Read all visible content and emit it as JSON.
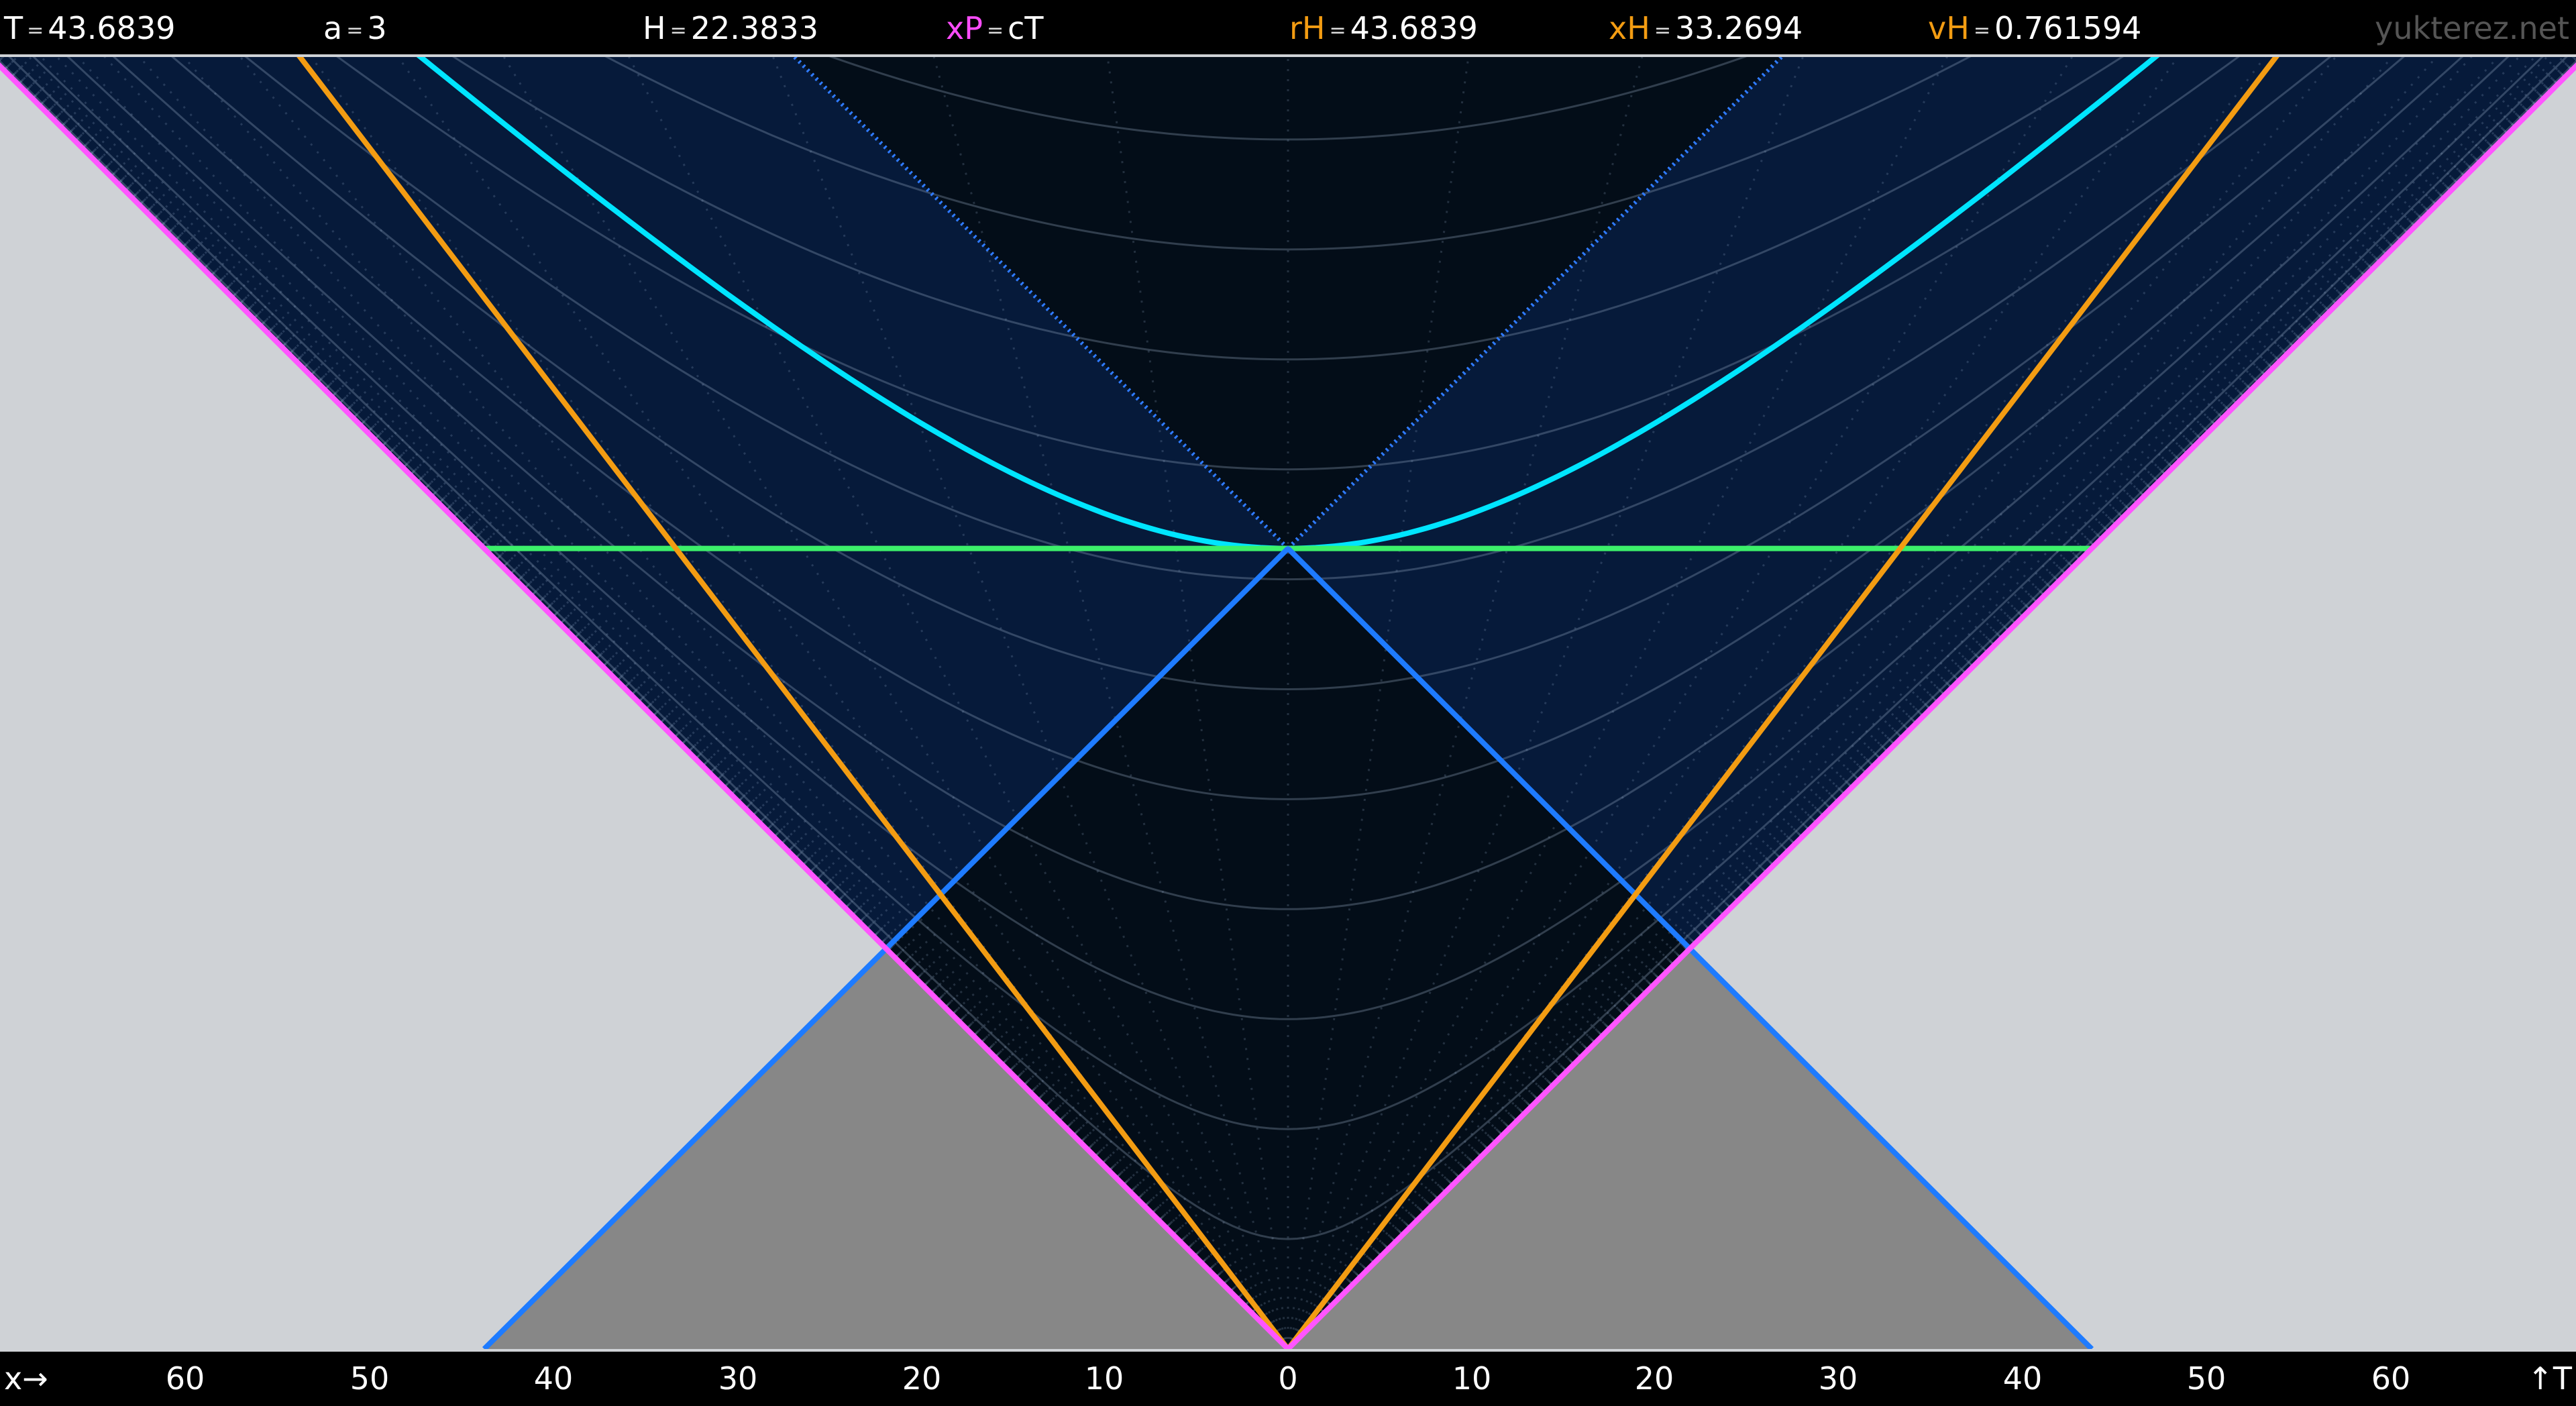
{
  "header": {
    "T": {
      "label": "T",
      "eq": "=",
      "value": "43.6839"
    },
    "a": {
      "label": "a",
      "eq": "=",
      "value": "3"
    },
    "H": {
      "label": "H",
      "eq": "=",
      "value": "22.3833"
    },
    "xP": {
      "label": "xP",
      "eq": "=",
      "value": "cT"
    },
    "rH": {
      "label": "rH",
      "eq": "=",
      "value": "43.6839"
    },
    "xH": {
      "label": "xH",
      "eq": "=",
      "value": "33.2694"
    },
    "vH": {
      "label": "vH",
      "eq": "=",
      "value": "0.761594"
    },
    "watermark": "yukterez.net"
  },
  "axis": {
    "x_label": "x→",
    "t_label": "↑T",
    "ticks": [
      "60",
      "50",
      "40",
      "30",
      "20",
      "10",
      "0",
      "10",
      "20",
      "30",
      "40",
      "50",
      "60"
    ]
  },
  "diagram": {
    "T": 43.6839,
    "a": 3,
    "H": 22.3833,
    "rH": 43.6839,
    "xH": 33.2694,
    "vH": 0.761594,
    "x_range": [
      -70,
      70
    ],
    "t_range": [
      0,
      70.5
    ],
    "colors": {
      "outside": "#cfd2d6",
      "past_shadow": "#878787",
      "light_cone": "#ff55ff",
      "signal_lines": "#1e7bff",
      "hubble_lines": "#f39c12",
      "hyperbola": "#00e5ff",
      "horizontal": "#3cf06a",
      "inner_dark": "#030d18",
      "outer_blue": "#061a3a"
    }
  }
}
